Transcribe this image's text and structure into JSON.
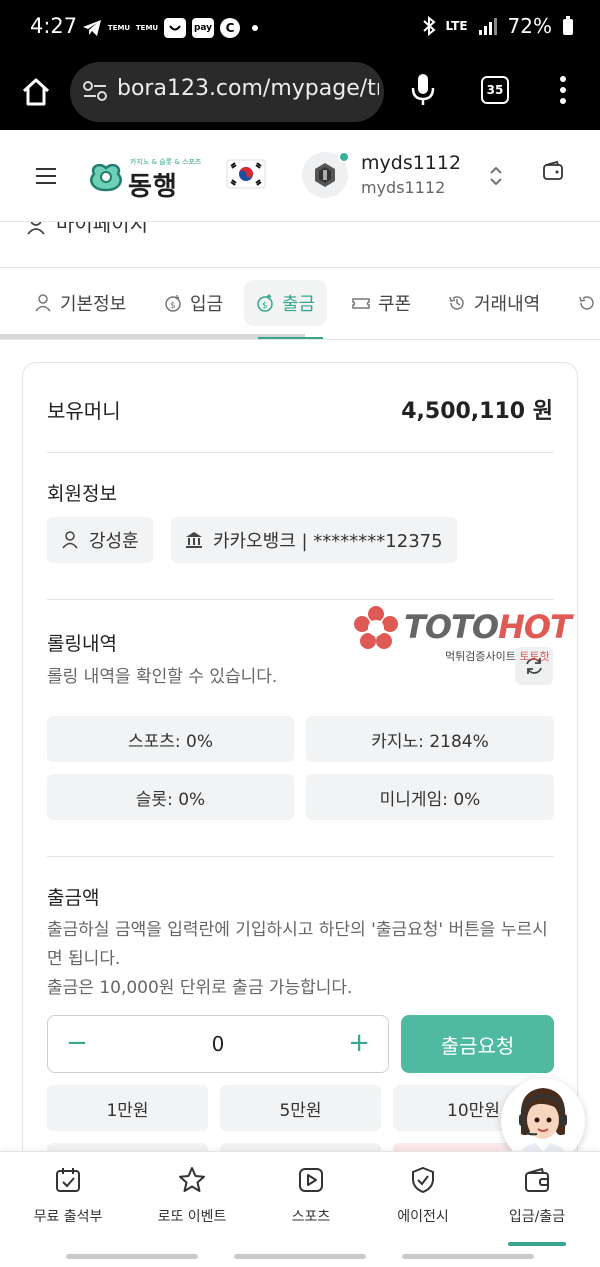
{
  "status_bar": {
    "time": "4:27",
    "icons": [
      "telegram-icon",
      "temu-icon",
      "temu-icon",
      "smile-icon",
      "pay-icon",
      "c-icon",
      "dot-icon"
    ],
    "temu_label": "TEMU",
    "pay_label": "pay",
    "c_label": "C",
    "network": "LTE",
    "battery": "72%"
  },
  "browser": {
    "url": "bora123.com/mypage/tr",
    "tab_count": "35"
  },
  "header": {
    "logo_tag": "카지노 & 슬롯 & 스포츠",
    "logo_name": "동행",
    "username": "myds1112",
    "user_id": "myds1112"
  },
  "mypage_title": "마이페이지",
  "tabs": [
    {
      "label": "기본정보",
      "icon": "user-icon"
    },
    {
      "label": "입금",
      "icon": "deposit-icon"
    },
    {
      "label": "출금",
      "icon": "withdraw-icon",
      "active": true
    },
    {
      "label": "쿠폰",
      "icon": "ticket-icon"
    },
    {
      "label": "거래내역",
      "icon": "history-icon"
    }
  ],
  "balance": {
    "label": "보유머니",
    "value": "4,500,110 원"
  },
  "member": {
    "title": "회원정보",
    "name": "강성훈",
    "bank": "카카오뱅크 | ********12375"
  },
  "rolling": {
    "title": "롤링내역",
    "desc": "롤링 내역을 확인할 수 있습니다.",
    "items": [
      "스포츠: 0%",
      "카지노: 2184%",
      "슬롯: 0%",
      "미니게임: 0%"
    ]
  },
  "withdraw": {
    "title": "출금액",
    "desc1": "출금하실 금액을 입력란에 기입하시고 하단의 '출금요청' 버튼을 누르시면 됩니다.",
    "desc2": "출금은 10,000원 단위로 출금 가능합니다.",
    "amount": "0",
    "minus": "−",
    "plus": "+",
    "button": "출금요청",
    "quick_amounts": [
      "1만원",
      "5만원",
      "10만원"
    ]
  },
  "watermark": {
    "brand_a": "TOTO",
    "brand_b": "HOT",
    "sub_a": "먹튀검증사이트 ",
    "sub_b": "토토핫"
  },
  "bottom_nav": [
    {
      "label": "무료 출석부",
      "icon": "calendar-check-icon"
    },
    {
      "label": "로또 이벤트",
      "icon": "star-icon"
    },
    {
      "label": "스포츠",
      "icon": "play-icon"
    },
    {
      "label": "에이전시",
      "icon": "shield-check-icon"
    },
    {
      "label": "입금/출금",
      "icon": "wallet-icon",
      "active": true
    }
  ],
  "colors": {
    "accent": "#38a58f",
    "button": "#4fb9a2",
    "watermark_red": "#e05a55"
  }
}
